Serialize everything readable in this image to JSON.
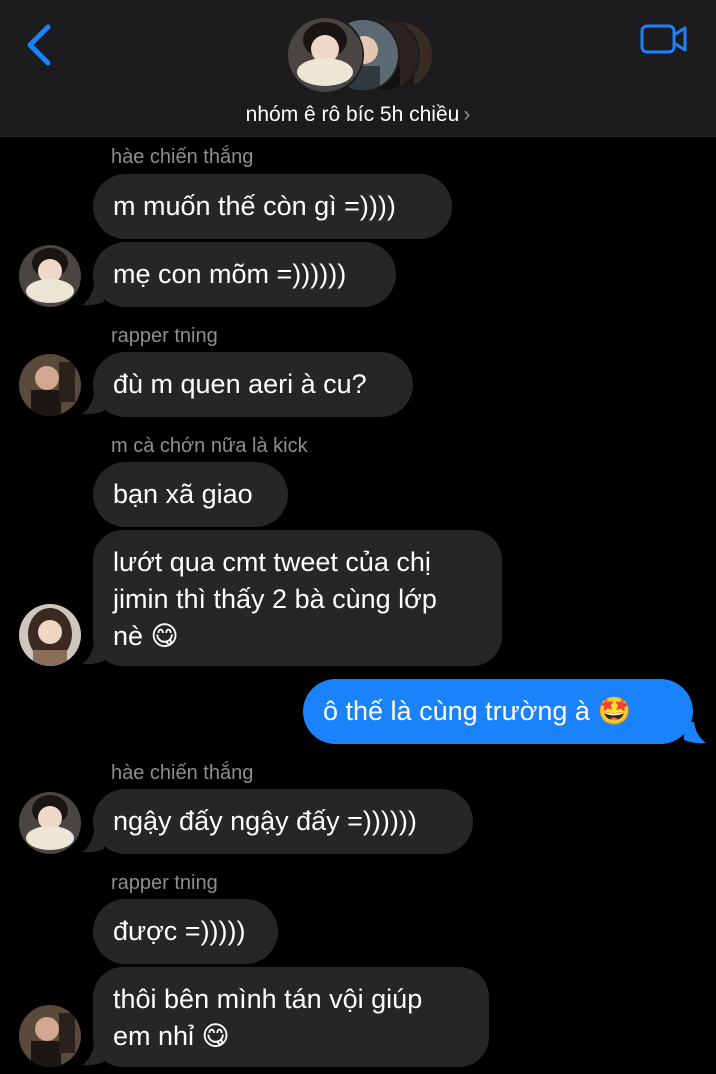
{
  "header": {
    "group_name": "nhóm ê rô bíc 5h chiều",
    "chevron": "›",
    "back_icon": "chevron-left-icon",
    "video_icon": "video-camera-icon",
    "accent": "#1a82fb"
  },
  "messages": [
    {
      "sender": "hàe chiến thắng",
      "text": "m muốn thế còn gì =))))"
    },
    {
      "text": "mẹ con mõm =))))))"
    },
    {
      "sender": "rapper tning",
      "text": "đù m quen aeri à cu?"
    },
    {
      "sender": "m cà chớn nữa là kick",
      "text": "bạn xã giao"
    },
    {
      "text": "lướt qua cmt tweet của chị\njimin thì thấy 2 bà cùng lớp\nnè 😋"
    },
    {
      "text": "ô thế là cùng trường à 🤩",
      "outgoing": true
    },
    {
      "sender": "hàe chiến thắng",
      "text": "ngậy đấy ngậy đấy =))))))"
    },
    {
      "sender": "rapper tning",
      "text": "được =)))))"
    },
    {
      "text": "thôi bên mình tán vội giúp\nem nhỉ 😋"
    }
  ],
  "colors": {
    "incoming_bubble": "#262628",
    "outgoing_bubble": "#1a82fb",
    "sender_label": "#8e8e93",
    "header_bg": "#1c1c1e"
  }
}
